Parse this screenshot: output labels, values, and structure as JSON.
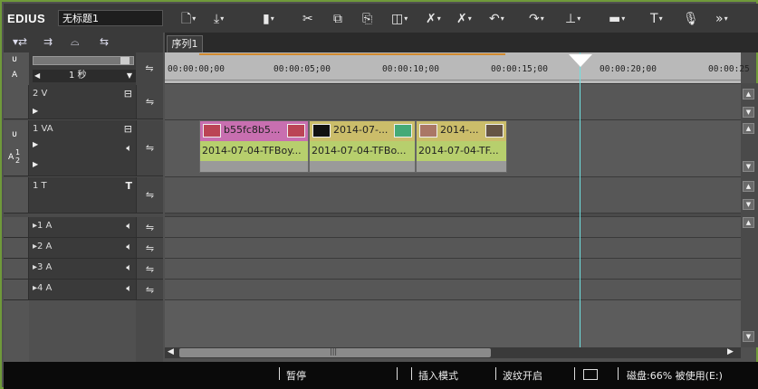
{
  "app": {
    "name": "EDIUS",
    "project_name": "无标题1"
  },
  "toolbar": [
    {
      "name": "new-project-icon",
      "glyph": "🗋",
      "caret": "▾"
    },
    {
      "name": "open-icon",
      "glyph": "⤓",
      "caret": "▾"
    },
    {
      "name": "save-icon",
      "glyph": "▮",
      "caret": "▾"
    },
    {
      "name": "cut-icon",
      "glyph": "✂",
      "caret": ""
    },
    {
      "name": "copy-icon",
      "glyph": "⧉",
      "caret": ""
    },
    {
      "name": "paste-icon",
      "glyph": "⎘",
      "caret": ""
    },
    {
      "name": "replace-icon",
      "glyph": "◫",
      "caret": "▾"
    },
    {
      "name": "delete-icon",
      "glyph": "✗",
      "caret": "▾"
    },
    {
      "name": "ripple-delete-icon",
      "glyph": "✗",
      "caret": "▾"
    },
    {
      "name": "undo-icon",
      "glyph": "↶",
      "caret": "▾"
    },
    {
      "name": "redo-icon",
      "glyph": "↷",
      "caret": "▾"
    },
    {
      "name": "insert-icon",
      "glyph": "⊥",
      "caret": "▾"
    },
    {
      "name": "marker-icon",
      "glyph": "▬",
      "caret": "▾"
    },
    {
      "name": "title-icon",
      "glyph": "T",
      "caret": "▾"
    },
    {
      "name": "microphone-icon",
      "glyph": "🎙",
      "caret": ""
    },
    {
      "name": "more-icon",
      "glyph": "»",
      "caret": "▾"
    }
  ],
  "left_tools": [
    "▾⇄",
    "⇉",
    "⌓",
    "⇆"
  ],
  "sequence_tab": "序列1",
  "timescale": {
    "label": "1 秒"
  },
  "ruler_ticks": [
    "00:00:00;00",
    "00:00:05;00",
    "00:00:10;00",
    "00:00:15;00",
    "00:00:20;00",
    "00:00:25"
  ],
  "tracks": {
    "v2": {
      "name": "2 V"
    },
    "va1": {
      "name": "1 VA",
      "a_label": "A",
      "a_sub": "1",
      "a_sub2": "2"
    },
    "t1": {
      "name": "1 T"
    },
    "a1": {
      "name": "▸1 A"
    },
    "a2": {
      "name": "▸2 A"
    },
    "a3": {
      "name": "▸3 A"
    },
    "a4": {
      "name": "▸4 A"
    }
  },
  "clips": [
    {
      "top_label": "b55fc8b5...",
      "bottom_label": "2014-07-04-TFBoy..."
    },
    {
      "top_label": "2014-07-...",
      "bottom_label": "2014-07-04-TFBo..."
    },
    {
      "top_label": "2014-...",
      "bottom_label": "2014-07-04-TF..."
    }
  ],
  "status": {
    "state": "暂停",
    "mode": "插入模式",
    "waveform": "波纹开启",
    "disk": "磁盘:66% 被使用(E:)"
  },
  "colors": {
    "frame": "#6f9a3a",
    "clip_top": "#cbbd6a",
    "clip_mid": "#b7cf6d",
    "cursor": "#6fe0e0",
    "clip1_top": "#c86fb0"
  }
}
